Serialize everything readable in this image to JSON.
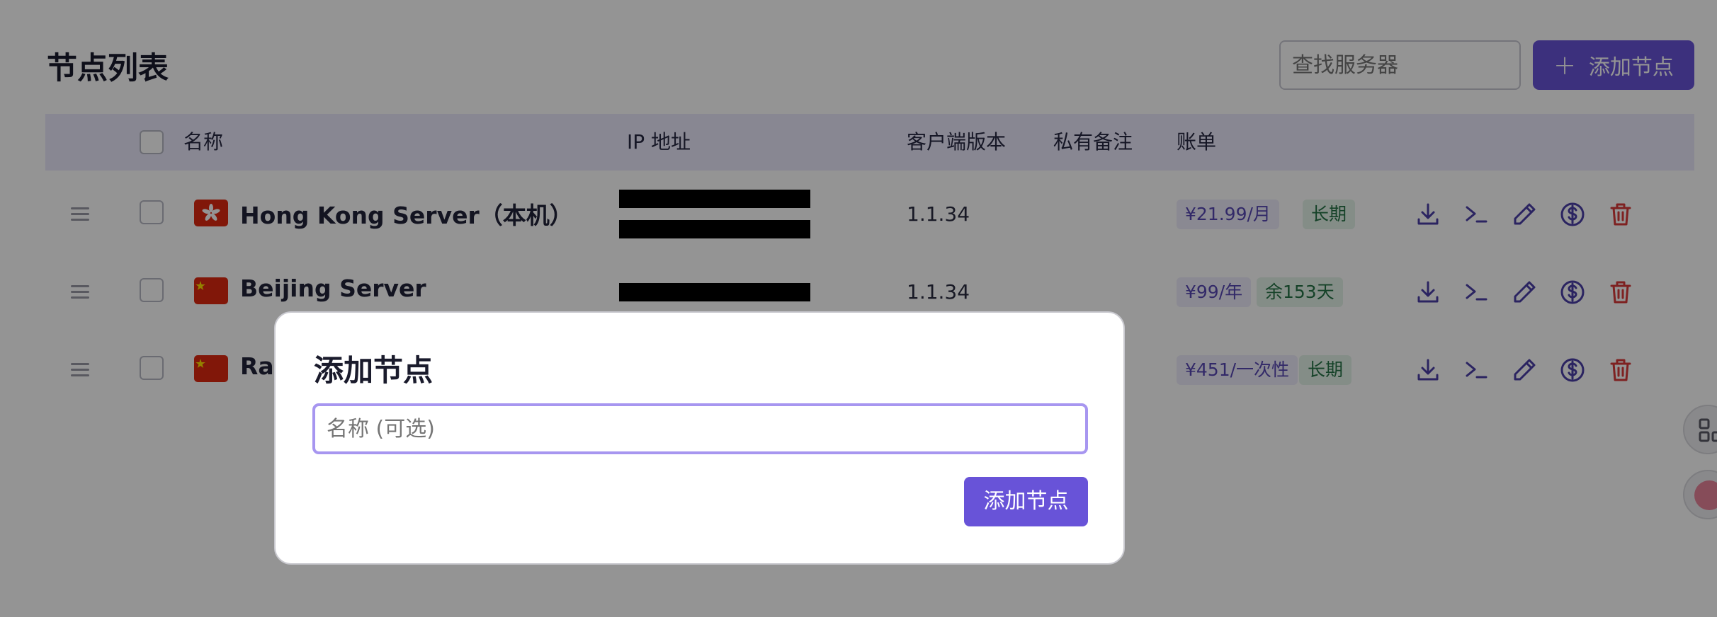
{
  "page": {
    "title": "节点列表",
    "search_placeholder": "查找服务器",
    "add_button_label": "添加节点"
  },
  "table": {
    "headers": [
      "名称",
      "IP 地址",
      "客户端版本",
      "私有备注",
      "账单"
    ],
    "rows": [
      {
        "flag": "hong-kong-flag",
        "name": "Hong Kong Server（本机）",
        "version": "1.1.34",
        "bill": "¥21.99/月",
        "term": "长期"
      },
      {
        "flag": "china-flag",
        "name": "Beijing Server",
        "version": "1.1.34",
        "bill": "¥99/年",
        "term": "余153天"
      },
      {
        "flag": "china-flag",
        "name": "Ras",
        "version": "",
        "bill": "¥451/一次性",
        "term": "长期"
      }
    ]
  },
  "modal": {
    "title": "添加节点",
    "input_placeholder": "名称 (可选)",
    "submit_label": "添加节点"
  },
  "colors": {
    "accent": "#6853d8",
    "danger": "#d93a3a",
    "header_bg": "#eae8fb"
  }
}
